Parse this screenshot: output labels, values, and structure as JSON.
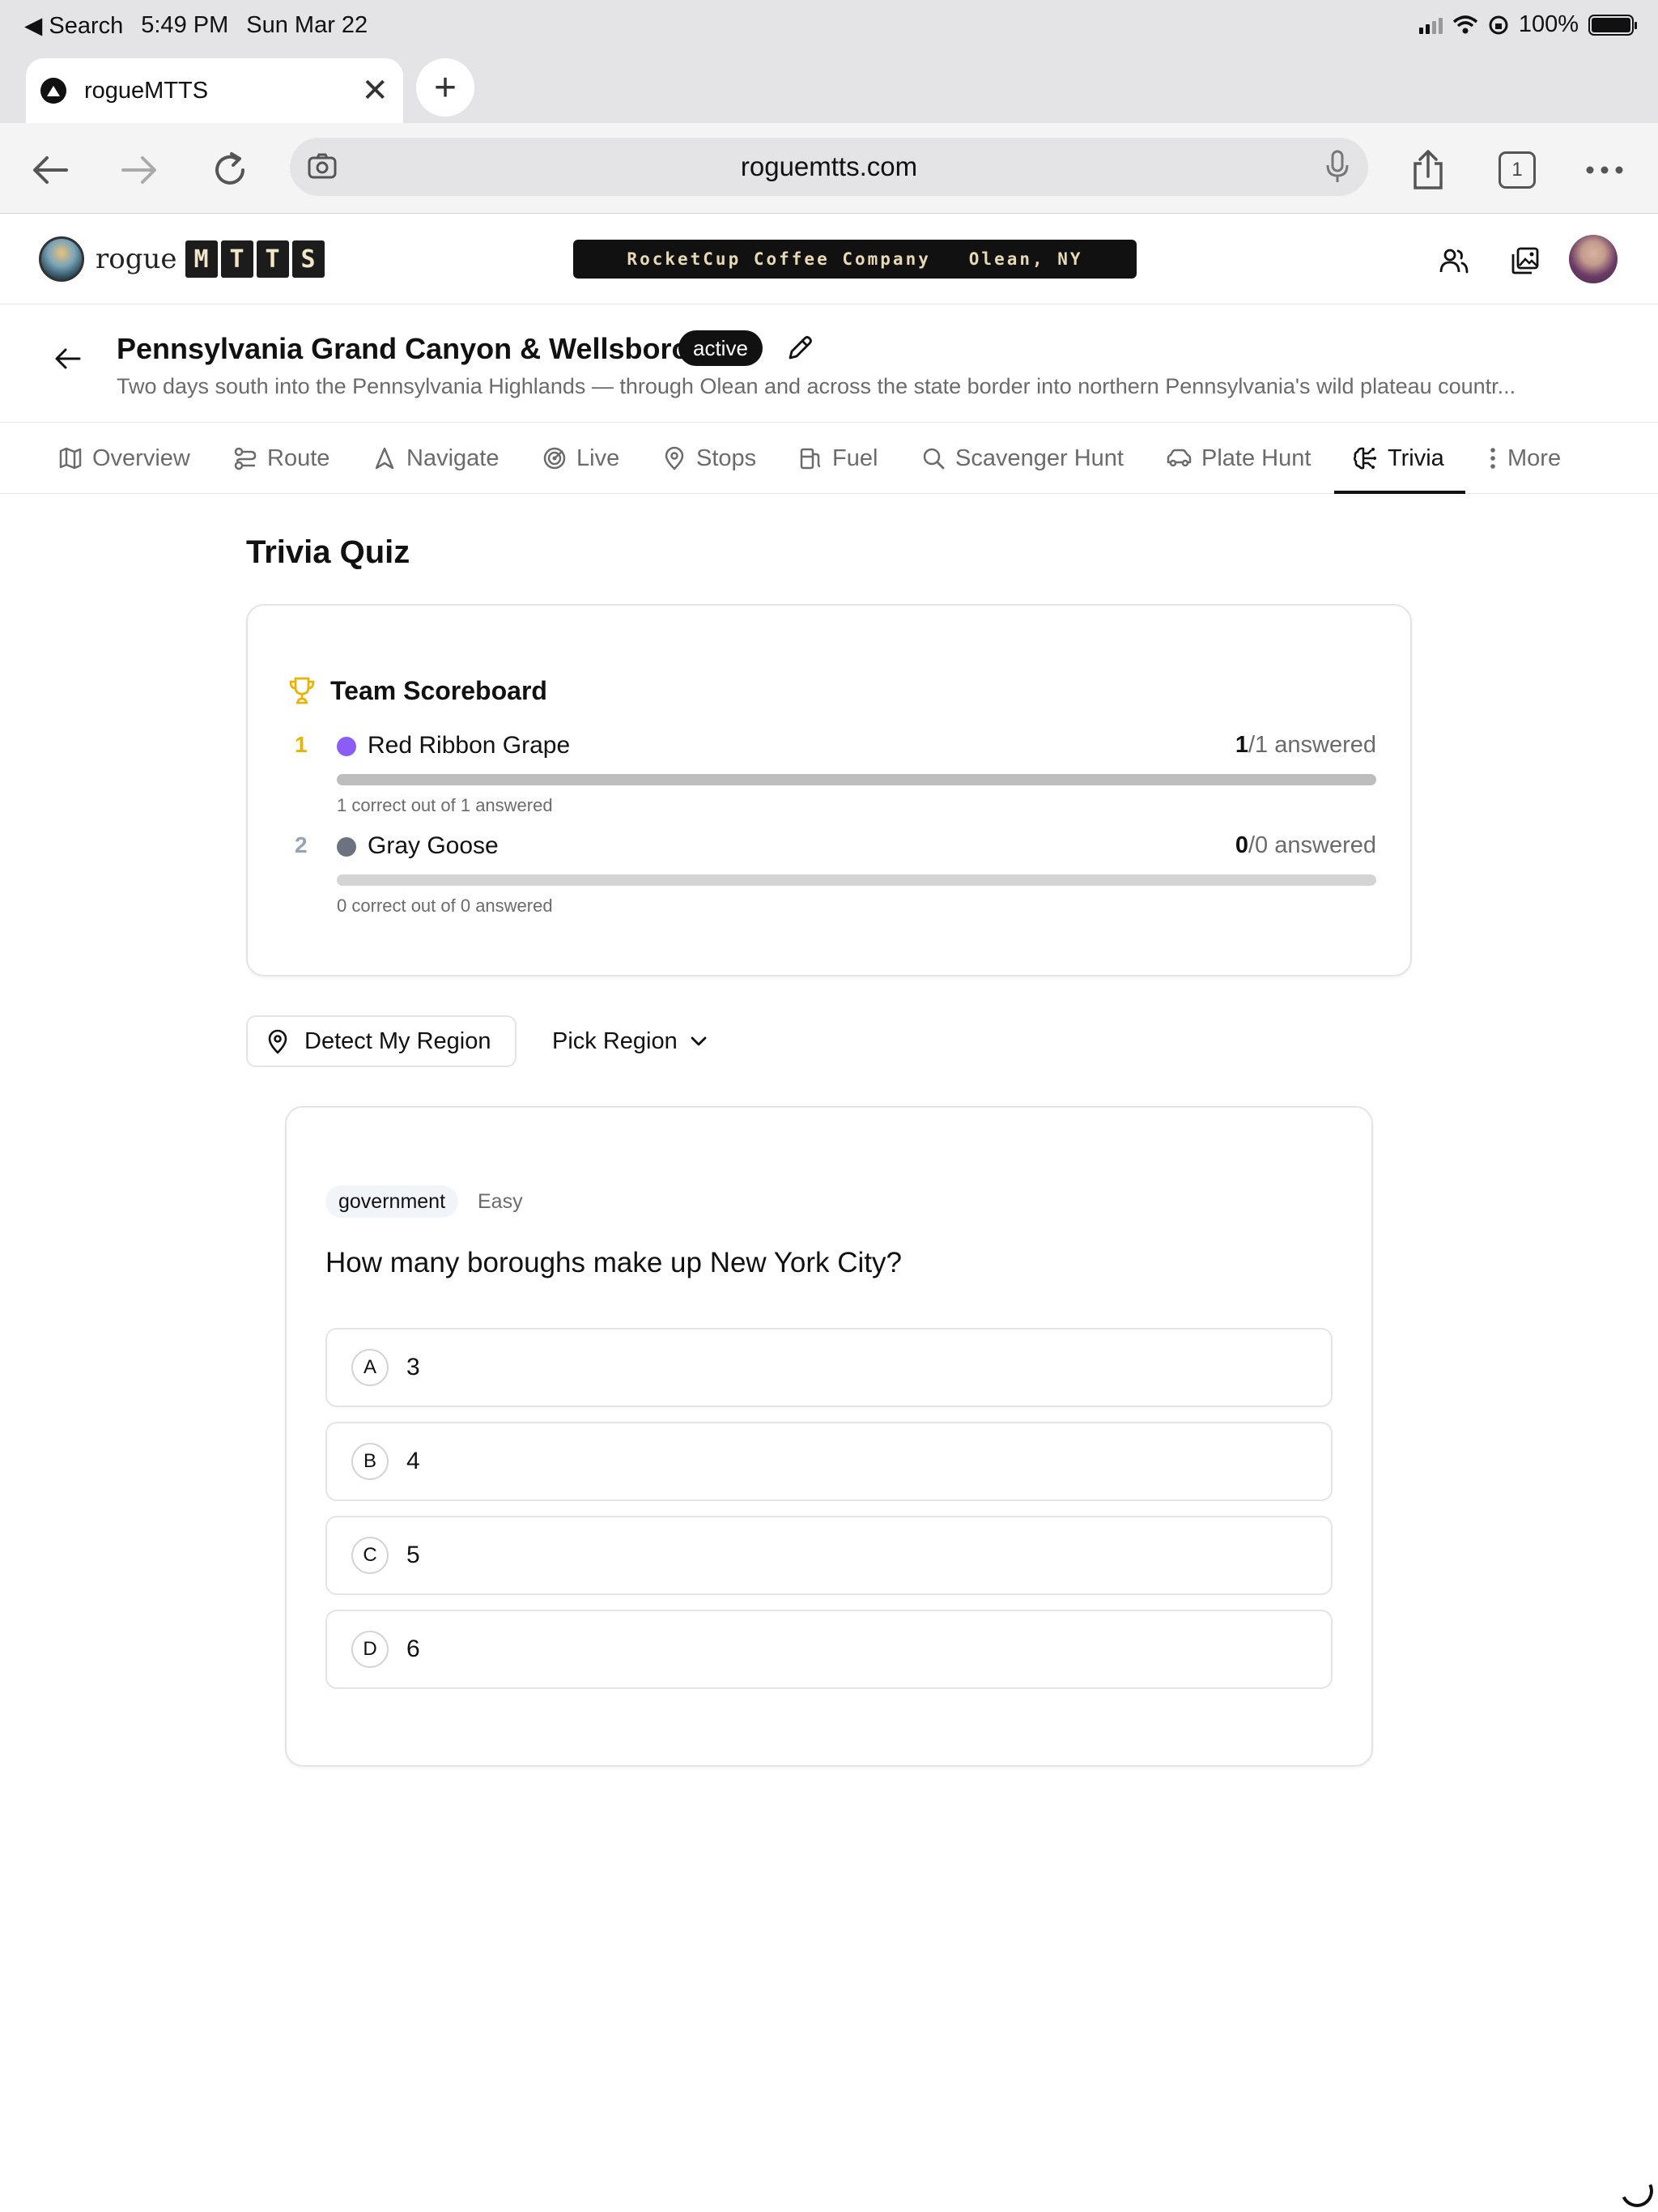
{
  "status_bar": {
    "back_label": "◀ Search",
    "time": "5:49 PM",
    "date": "Sun Mar 22",
    "battery": "100%"
  },
  "browser": {
    "tab_title": "rogueMTTS",
    "new_tab": "+",
    "url": "roguemtts.com",
    "tab_count": "1"
  },
  "app": {
    "logo_word": "rogue",
    "logo_letters": [
      "M",
      "T",
      "T",
      "S"
    ],
    "ticker": "RocketCup Coffee Company   Olean, NY"
  },
  "trip": {
    "title": "Pennsylvania Grand Canyon & Wellsboro",
    "status": "active",
    "description": "Two days south into the Pennsylvania Highlands — through Olean and across the state border into northern Pennsylvania's wild plateau countr..."
  },
  "nav": {
    "tabs": [
      {
        "label": "Overview",
        "icon": "map-icon"
      },
      {
        "label": "Route",
        "icon": "route-icon"
      },
      {
        "label": "Navigate",
        "icon": "navigation-arrow-icon"
      },
      {
        "label": "Live",
        "icon": "radar-icon"
      },
      {
        "label": "Stops",
        "icon": "map-pin-icon"
      },
      {
        "label": "Fuel",
        "icon": "fuel-pump-icon"
      },
      {
        "label": "Scavenger Hunt",
        "icon": "search-icon"
      },
      {
        "label": "Plate Hunt",
        "icon": "car-icon"
      },
      {
        "label": "Trivia",
        "icon": "brain-icon"
      },
      {
        "label": "More",
        "icon": "more-vertical-icon"
      }
    ],
    "active": "Trivia"
  },
  "trivia": {
    "heading": "Trivia Quiz",
    "scoreboard": {
      "title": "Team Scoreboard",
      "teams": [
        {
          "rank": "1",
          "name": "Red Ribbon Grape",
          "correct": "1",
          "answered_text": "/1 answered",
          "progress": 1.0,
          "summary": "1 correct out of 1 answered",
          "color": "#8b5cf6",
          "rank_color": "#eab308"
        },
        {
          "rank": "2",
          "name": "Gray Goose",
          "correct": "0",
          "answered_text": "/0 answered",
          "progress": 0.0,
          "summary": "0 correct out of 0 answered",
          "color": "#6b7280",
          "rank_color": "#94a3b8"
        }
      ]
    },
    "detect_region_label": "Detect My Region",
    "pick_region_label": "Pick Region",
    "question": {
      "category": "government",
      "difficulty": "Easy",
      "text": "How many boroughs make up New York City?",
      "options": [
        {
          "letter": "A",
          "value": "3"
        },
        {
          "letter": "B",
          "value": "4"
        },
        {
          "letter": "C",
          "value": "5"
        },
        {
          "letter": "D",
          "value": "6"
        }
      ]
    }
  },
  "colors": {
    "accent": "#111111",
    "trophy": "#eab308",
    "muted_text": "#6b6b6b",
    "border": "#e4e4e7"
  }
}
